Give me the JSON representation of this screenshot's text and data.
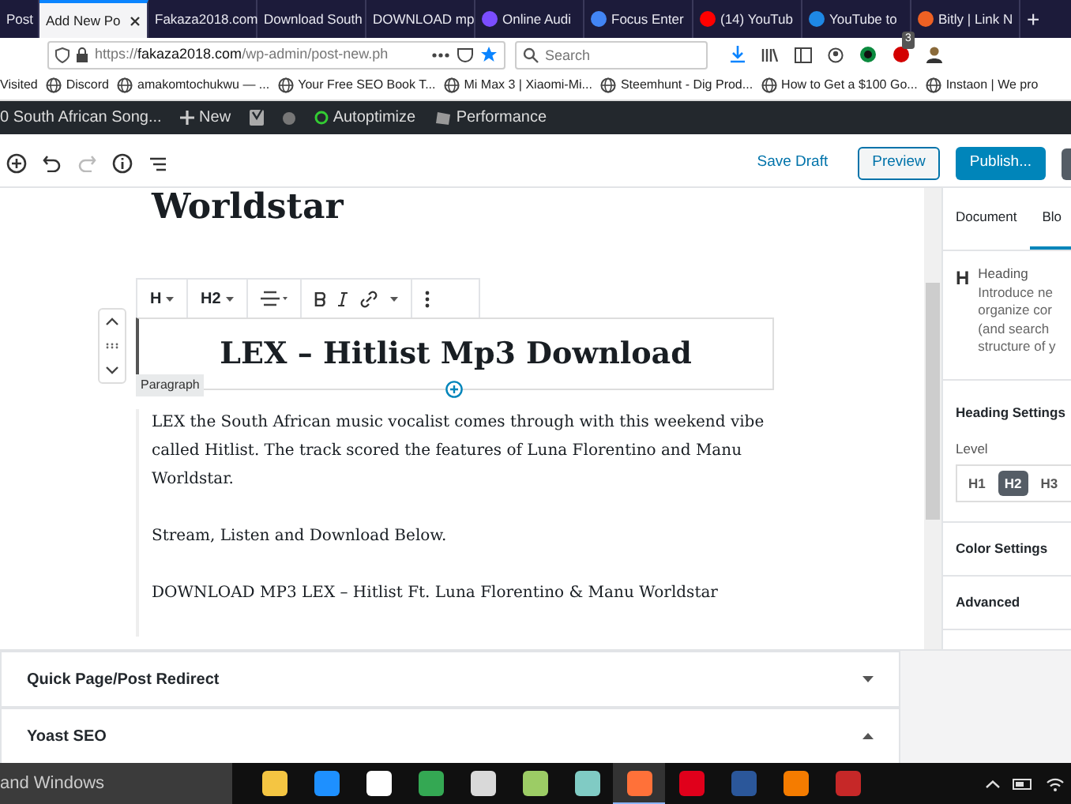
{
  "browser_tabs": [
    {
      "label": "Post",
      "selected": false,
      "closable": false
    },
    {
      "label": "Add New Po",
      "selected": true,
      "closable": true
    },
    {
      "label": "Fakaza2018.com",
      "selected": false,
      "closable": false
    },
    {
      "label": "Download South",
      "selected": false,
      "closable": false
    },
    {
      "label": "DOWNLOAD mp",
      "selected": false,
      "closable": false
    },
    {
      "label": "Online Audi",
      "selected": false,
      "closable": false,
      "color": "#7b4dff"
    },
    {
      "label": "Focus Enter",
      "selected": false,
      "closable": false,
      "color": "#4285f4"
    },
    {
      "label": "(14) YouTub",
      "selected": false,
      "closable": false,
      "color": "#ff0000"
    },
    {
      "label": "YouTube to",
      "selected": false,
      "closable": false,
      "color": "#1e88e5"
    },
    {
      "label": "Bitly | Link N",
      "selected": false,
      "closable": false,
      "color": "#ee6123"
    }
  ],
  "new_tab": "+",
  "address": {
    "scheme": "https://",
    "domain": "fakaza2018.com",
    "path": "/wp-admin/post-new.ph"
  },
  "search": {
    "placeholder": "Search"
  },
  "notification_badge": "3",
  "bookmarks": [
    "Visited",
    "Discord",
    "amakomtochukwu — ...",
    "Your Free SEO Book T...",
    "Mi Max 3 | Xiaomi-Mi...",
    "Steemhunt - Dig Prod...",
    "How to Get a $100 Go...",
    "Instaon | We pro"
  ],
  "admin_bar": {
    "site": "0 South African Song...",
    "new": "New",
    "autoptimize": "Autoptimize",
    "performance": "Performance"
  },
  "editor_header": {
    "save_draft": "Save Draft",
    "preview": "Preview",
    "publish": "Publish..."
  },
  "title_tail": "Worldstar",
  "block_toolbar": {
    "style": "H",
    "level": "H2"
  },
  "heading": "LEX – Hitlist Mp3 Download",
  "block_label": "Paragraph",
  "paragraphs": [
    "LEX the South African music vocalist comes through with this weekend vibe called Hitlist. The track scored the features of Luna Florentino and Manu Worldstar.",
    "Stream, Listen and Download Below.",
    "DOWNLOAD MP3 LEX – Hitlist Ft. Luna Florentino & Manu Worldstar"
  ],
  "sidebar": {
    "tabs": [
      {
        "label": "Document",
        "selected": false
      },
      {
        "label": "Blo",
        "selected": true
      }
    ],
    "block_icon": "H",
    "block_name": "Heading",
    "block_description": [
      "Introduce ne",
      "organize cor",
      "(and search",
      "structure of y"
    ],
    "heading_settings": "Heading Settings",
    "level_label": "Level",
    "levels": [
      {
        "label": "H1",
        "selected": false
      },
      {
        "label": "H2",
        "selected": true
      },
      {
        "label": "H3",
        "selected": false
      }
    ],
    "color_settings": "Color Settings",
    "advanced": "Advanced"
  },
  "meta_boxes": [
    {
      "title": "Quick Page/Post Redirect",
      "expanded": false
    },
    {
      "title": "Yoast SEO",
      "expanded": true
    }
  ],
  "taskbar": {
    "search": "and Windows",
    "apps": [
      {
        "color": "#f4c542",
        "active": false
      },
      {
        "color": "#1e90ff",
        "active": false
      },
      {
        "color": "#ffffff",
        "active": false
      },
      {
        "color": "#34a853",
        "active": false
      },
      {
        "color": "#d9d9d9",
        "active": false
      },
      {
        "color": "#9ccc65",
        "active": false
      },
      {
        "color": "#80cbc4",
        "active": false
      },
      {
        "color": "#ff7139",
        "active": true
      },
      {
        "color": "#e0001b",
        "active": false
      },
      {
        "color": "#2b579a",
        "active": false
      },
      {
        "color": "#f57c00",
        "active": false
      },
      {
        "color": "#c62828",
        "active": false
      }
    ]
  }
}
